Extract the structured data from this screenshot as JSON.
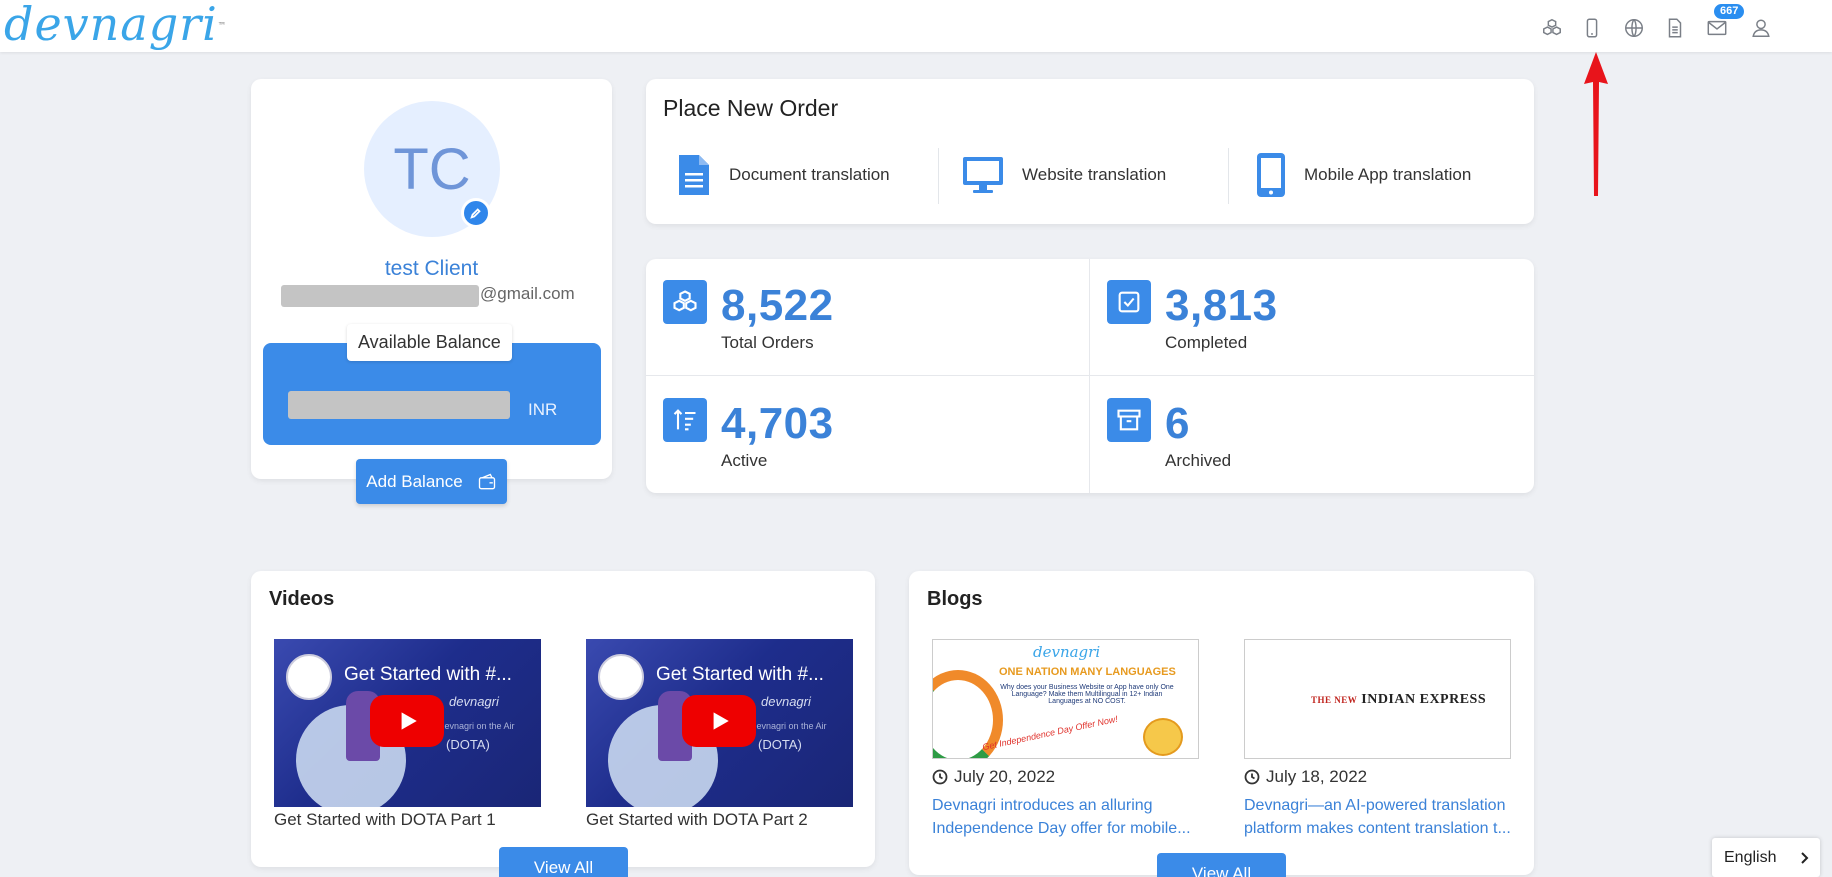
{
  "header": {
    "logo": "devnagri",
    "logo_tm": "™",
    "notification_count": "667",
    "icons": [
      "cubes-icon",
      "mobile-icon",
      "globe-icon",
      "document-icon",
      "mail-icon",
      "user-icon"
    ]
  },
  "profile": {
    "initials": "TC",
    "name": "test Client",
    "email_suffix": "@gmail.com",
    "balance_label": "Available Balance",
    "currency": "INR",
    "add_balance": "Add Balance"
  },
  "place_order": {
    "title": "Place New Order",
    "options": [
      {
        "label": "Document translation",
        "icon": "document-icon"
      },
      {
        "label": "Website translation",
        "icon": "monitor-icon"
      },
      {
        "label": "Mobile App translation",
        "icon": "mobile-icon"
      }
    ]
  },
  "stats": [
    {
      "value": "8,522",
      "label": "Total Orders",
      "icon": "cubes-icon"
    },
    {
      "value": "3,813",
      "label": "Completed",
      "icon": "checkbox-icon"
    },
    {
      "value": "4,703",
      "label": "Active",
      "icon": "sort-icon"
    },
    {
      "value": "6",
      "label": "Archived",
      "icon": "archive-icon"
    }
  ],
  "videos": {
    "title": "Videos",
    "items": [
      {
        "thumb_title": "Get Started with #...",
        "caption": "Get Started with DOTA Part 1",
        "brand": "devnagri",
        "tag": "(DOTA)",
        "sub": "Devnagri on the Air"
      },
      {
        "thumb_title": "Get Started with #...",
        "caption": "Get Started with DOTA Part 2",
        "brand": "devnagri",
        "tag": "(DOTA)",
        "sub": "Devnagri on the Air"
      }
    ],
    "view_all": "View All"
  },
  "blogs": {
    "title": "Blogs",
    "items": [
      {
        "date": "July 20, 2022",
        "line1": "Devnagri introduces an alluring",
        "line2": "Independence Day offer for mobile...",
        "img_logo": "devnagri",
        "img_head": "ONE NATION MANY LANGUAGES",
        "img_sub": "Why does your Business Website or App have only One Language? Make them Multilingual in 12+ Indian Languages at NO COST.",
        "img_offer": "Get Independence Day Offer Now!"
      },
      {
        "date": "July 18, 2022",
        "line1": "Devnagri—an AI-powered translation",
        "line2": "platform makes content translation t...",
        "img_pre": "THE NEW",
        "img_title": "INDIAN EXPRESS"
      }
    ],
    "view_all": "View All"
  },
  "language": "English",
  "colors": {
    "accent": "#3b8be8",
    "link": "#3b82d8",
    "annotation": "#e8141b"
  }
}
